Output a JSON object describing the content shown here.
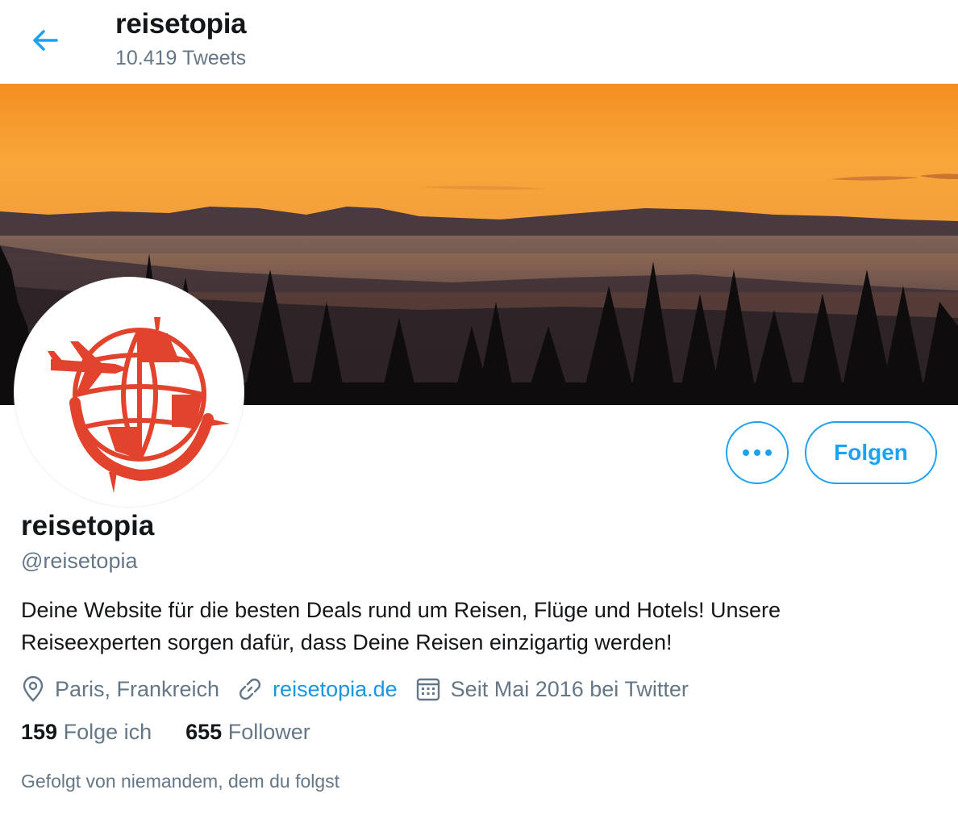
{
  "header": {
    "title": "reisetopia",
    "tweet_count": "10.419 Tweets"
  },
  "profile": {
    "name": "reisetopia",
    "handle": "@reisetopia",
    "bio": "Deine Website für die besten Deals rund um Reisen, Flüge und Hotels! Unsere Reiseexperten sorgen dafür, dass Deine Reisen einzigartig werden!",
    "location": "Paris, Frankreich",
    "website": "reisetopia.de",
    "joined": "Seit Mai 2016 bei Twitter",
    "following_count": "159",
    "following_label": "Folge ich",
    "followers_count": "655",
    "followers_label": "Follower",
    "followed_by": "Gefolgt von niemandem, dem du folgst"
  },
  "actions": {
    "follow_label": "Folgen",
    "more_icon": "more-dots-icon"
  },
  "icons": {
    "back": "arrow-left-icon",
    "location": "location-pin-icon",
    "link": "link-icon",
    "calendar": "calendar-icon"
  },
  "colors": {
    "accent": "#1da1f2",
    "link": "#1b95e0",
    "secondary_text": "#657786",
    "logo_red": "#e2432c"
  }
}
